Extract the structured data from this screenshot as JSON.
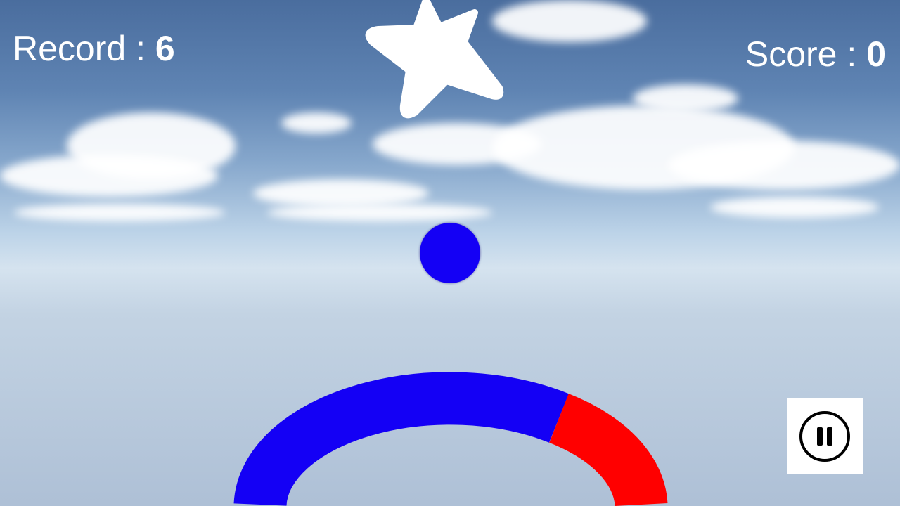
{
  "hud": {
    "record_label": "Record :",
    "record_value": "6",
    "score_label": "Score :",
    "score_value": "0"
  },
  "game": {
    "ball_color": "#1400f5",
    "ring_colors": [
      "#1400f5",
      "#ff0000"
    ],
    "star_color": "#ffffff",
    "sky_color": "#5f84b3"
  },
  "controls": {
    "pause_icon": "pause-icon"
  }
}
